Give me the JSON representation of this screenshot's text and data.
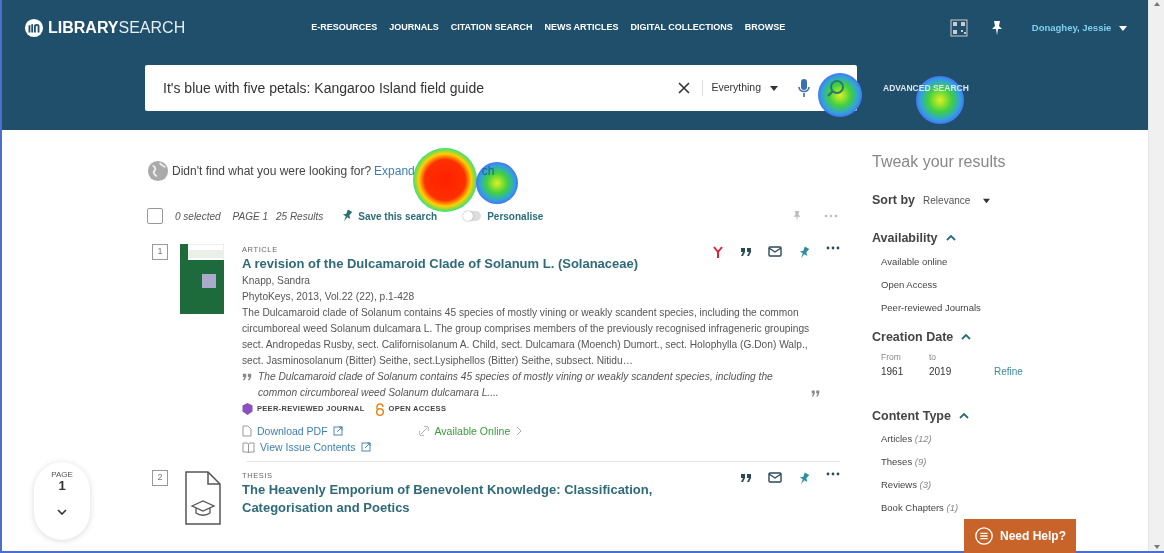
{
  "header": {
    "logo_bold": "LIBRARY",
    "logo_light": "SEARCH",
    "nav": [
      {
        "label": "E-RESOURCES",
        "selected": false
      },
      {
        "label": "JOURNALS",
        "selected": false
      },
      {
        "label": "CITATION SEARCH",
        "selected": false
      },
      {
        "label": "NEWS ARTICLES",
        "selected": false
      },
      {
        "label": "DIGITAL COLLECTIONS",
        "selected": false
      },
      {
        "label": "BROWSE",
        "selected": false
      }
    ],
    "user": "Donaghey, Jessie"
  },
  "search": {
    "query": "It's blue with five petals: Kangaroo Island field guide",
    "scope": "Everything",
    "advanced": "ADVANCED SEARCH"
  },
  "notice": {
    "text": "Didn't find what you were looking for?",
    "link": "Expand",
    "link_tail": "ch"
  },
  "toolbar": {
    "select_all": {
      "checked": false
    },
    "selected": "0 selected",
    "page": "PAGE 1",
    "results": "25 Results",
    "save": "Save this search",
    "personalise": {
      "label": "Personalise",
      "on": false
    }
  },
  "results": [
    {
      "index": "1",
      "kind": "article",
      "type": "ARTICLE",
      "title": "A revision of the Dulcamaroid Clade of  Solanum L. (Solanaceae)",
      "author": "Knapp, Sandra",
      "source": "PhytoKeys, 2013, Vol.22 (22), p.1-428",
      "abstract": "The Dulcamaroid clade of Solanum contains 45 species of mostly vining or weakly scandent species, including the common circumboreal weed Solanum dulcamara L. The group comprises members of the previously recognised infrageneric groupings sect. Andropedas Rusby, sect. Californisolanum A. Child, sect. Dulcamara (Moench) Dumort., sect. Holophylla (G.Don) Walp., sect. Jasminosolanum (Bitter) Seithe, sect.Lysiphellos (Bitter) Seithe, subsect. Nitidu…",
      "snippet": "The Dulcamaroid clade of Solanum contains 45 species of mostly vining or weakly scandent species, including the common circumboreal weed Solanum dulcamara L....",
      "badges": [
        {
          "kind": "peer",
          "label": "PEER-REVIEWED JOURNAL"
        },
        {
          "kind": "open",
          "label": "OPEN ACCESS"
        }
      ],
      "links": [
        {
          "kind": "pdf",
          "label": "Download PDF"
        },
        {
          "kind": "issue",
          "label": "View Issue Contents"
        }
      ],
      "availability": "Available Online",
      "citation_trail": true
    },
    {
      "index": "2",
      "kind": "thesis",
      "type": "THESIS",
      "title": "The Heavenly Emporium of Benevolent Knowledge: Classification, Categorisation and Poetics",
      "citation_trail": false
    }
  ],
  "pager": {
    "label": "PAGE",
    "page": "1"
  },
  "sidebar": {
    "title": "Tweak your results",
    "sort_label": "Sort by",
    "sort_value": "Relevance",
    "availability": {
      "title": "Availability",
      "expanded": true,
      "items": [
        "Available online",
        "Open Access",
        "Peer-reviewed Journals"
      ]
    },
    "creation_date": {
      "title": "Creation Date",
      "expanded": true,
      "from_label": "From",
      "to_label": "to",
      "from": "1961",
      "to": "2019",
      "refine": "Refine"
    },
    "content_type": {
      "title": "Content Type",
      "expanded": true,
      "items": [
        {
          "label": "Articles",
          "count": "(12)"
        },
        {
          "label": "Theses",
          "count": "(9)"
        },
        {
          "label": "Reviews",
          "count": "(3)"
        },
        {
          "label": "Book Chapters",
          "count": "(1)"
        }
      ]
    }
  },
  "help": "Need Help?"
}
